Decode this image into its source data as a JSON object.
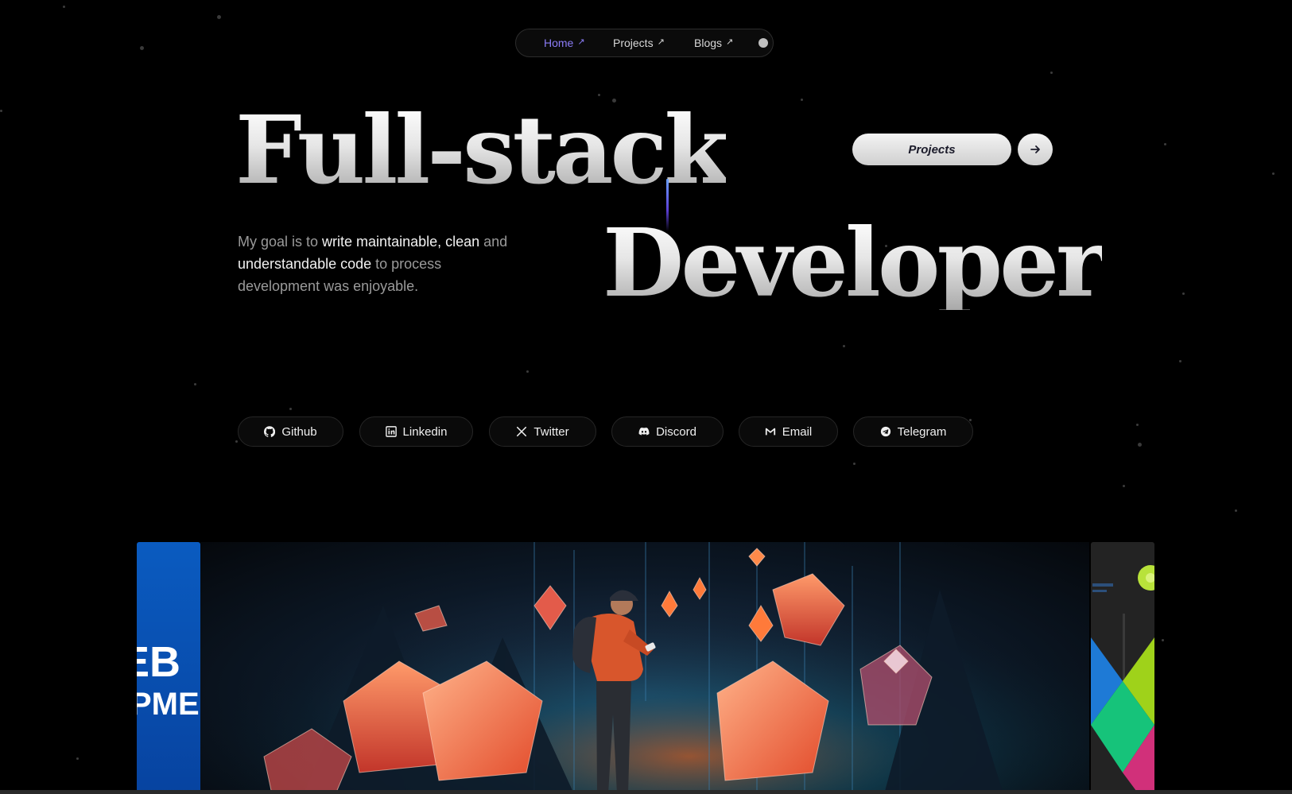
{
  "nav": {
    "items": [
      {
        "label": "Home",
        "active": true
      },
      {
        "label": "Projects",
        "active": false
      },
      {
        "label": "Blogs",
        "active": false
      }
    ],
    "external_icon": "↗",
    "theme_toggle_icon": "theme-dot-icon"
  },
  "hero": {
    "line1": "Full-stack",
    "line2": "Developer"
  },
  "cta": {
    "label": "Projects",
    "arrow_icon": "arrow-right-icon"
  },
  "intro": {
    "p1": "My goal is to ",
    "h1": "write maintainable, clean",
    "p2": " and ",
    "h2": "understandable code",
    "p3": " to process development was enjoyable."
  },
  "socials": [
    {
      "label": "Github",
      "icon": "github-icon"
    },
    {
      "label": "Linkedin",
      "icon": "linkedin-icon"
    },
    {
      "label": "Twitter",
      "icon": "x-icon"
    },
    {
      "label": "Discord",
      "icon": "discord-icon"
    },
    {
      "label": "Email",
      "icon": "gmail-icon"
    },
    {
      "label": "Telegram",
      "icon": "telegram-icon"
    }
  ],
  "carousel": {
    "left_card_text": [
      "EB",
      "PME"
    ]
  },
  "colors": {
    "background": "#000000",
    "accent": "#8b7cf6",
    "hero_text": "#e6e6e6",
    "muted_text": "#9a9a9a"
  }
}
